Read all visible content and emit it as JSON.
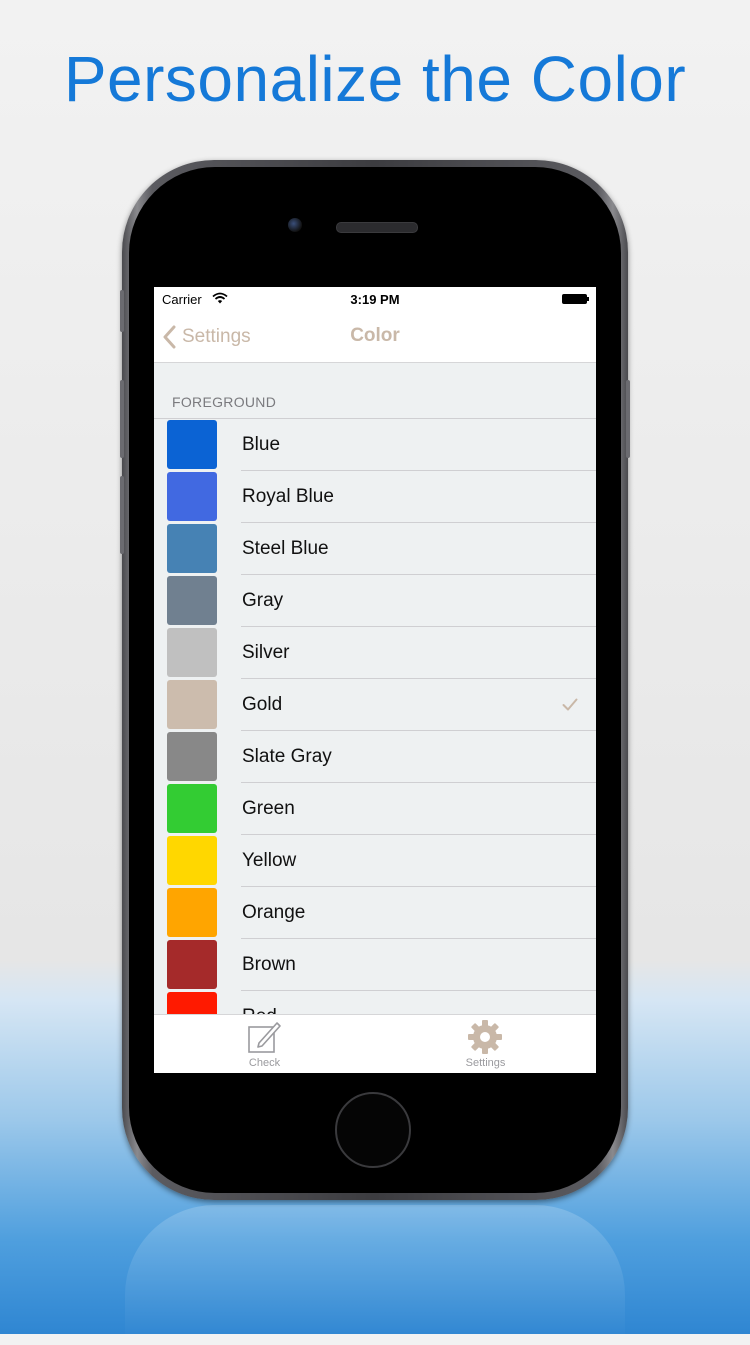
{
  "headline": "Personalize the Color",
  "status_bar": {
    "carrier": "Carrier",
    "time": "3:19 PM"
  },
  "nav": {
    "back_label": "Settings",
    "title": "Color"
  },
  "section_header": "FOREGROUND",
  "colors": [
    {
      "label": "Blue",
      "color": "#0b63d4",
      "selected": false
    },
    {
      "label": "Royal Blue",
      "color": "#4169e1",
      "selected": false
    },
    {
      "label": "Steel Blue",
      "color": "#4682b4",
      "selected": false
    },
    {
      "label": "Gray",
      "color": "#708090",
      "selected": false
    },
    {
      "label": "Silver",
      "color": "#c0c0c0",
      "selected": false
    },
    {
      "label": "Gold",
      "color": "#ccbcad",
      "selected": true
    },
    {
      "label": "Slate Gray",
      "color": "#888888",
      "selected": false
    },
    {
      "label": "Green",
      "color": "#33cc33",
      "selected": false
    },
    {
      "label": "Yellow",
      "color": "#ffd700",
      "selected": false
    },
    {
      "label": "Orange",
      "color": "#ffa500",
      "selected": false
    },
    {
      "label": "Brown",
      "color": "#a52a2a",
      "selected": false
    },
    {
      "label": "Red",
      "color": "#ff1a00",
      "selected": false
    }
  ],
  "tab_bar": {
    "tabs": [
      {
        "label": "Check",
        "icon": "compose-icon"
      },
      {
        "label": "Settings",
        "icon": "gear-icon"
      }
    ]
  },
  "theme": {
    "accent": "#c9b8a8",
    "headline_color": "#1579d8"
  }
}
